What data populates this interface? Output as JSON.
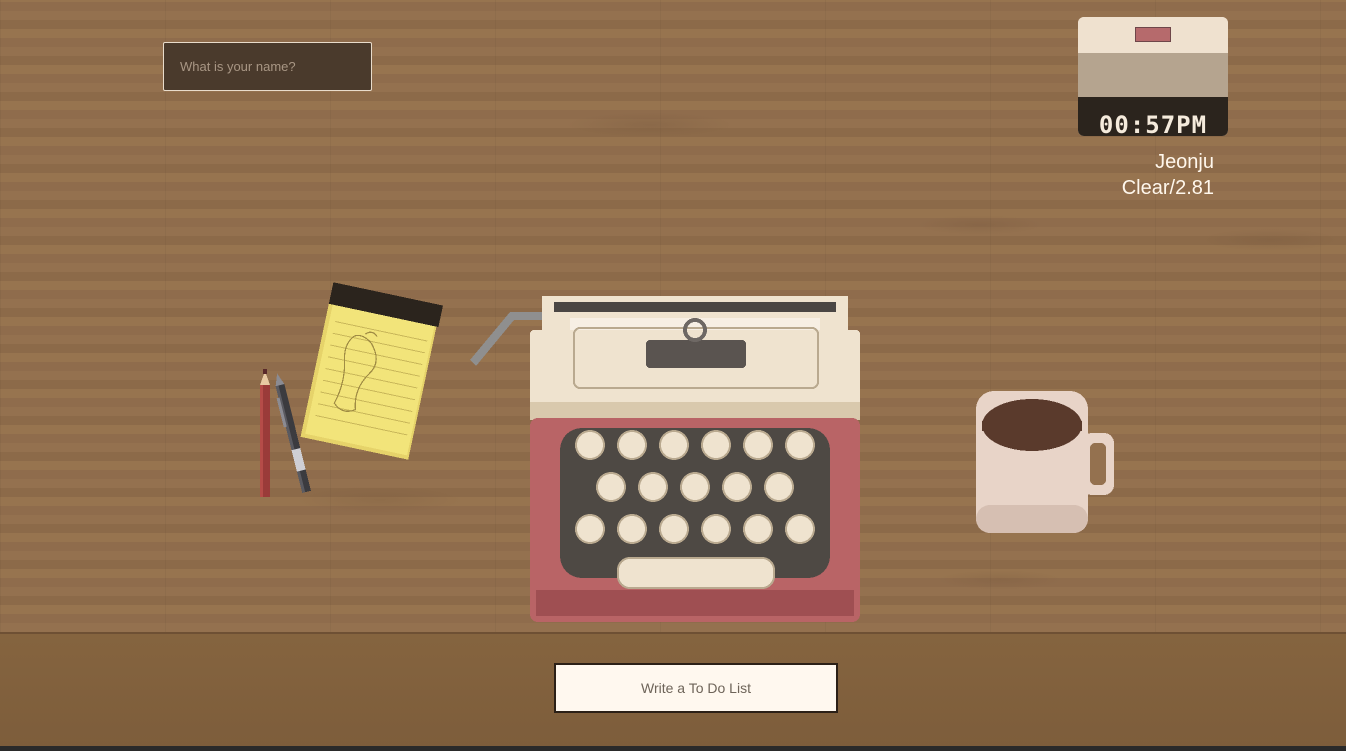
{
  "name_input": {
    "placeholder": "What is your name?",
    "value": ""
  },
  "clock": {
    "time": "00:57PM"
  },
  "weather": {
    "city": "Jeonju",
    "condition": "Clear/2.81"
  },
  "todo_button": {
    "label": "Write a To Do List"
  },
  "colors": {
    "desk": "#94714f",
    "shelf": "#85643f",
    "typewriter_body": "#b96466",
    "typewriter_cream": "#efe3cf",
    "notepad": "#f2e47a",
    "coffee": "#5a3a2c"
  },
  "icons": [
    "notepad-icon",
    "pencil-icon",
    "pen-icon",
    "typewriter-icon",
    "coffee-mug-icon",
    "clock-icon"
  ]
}
